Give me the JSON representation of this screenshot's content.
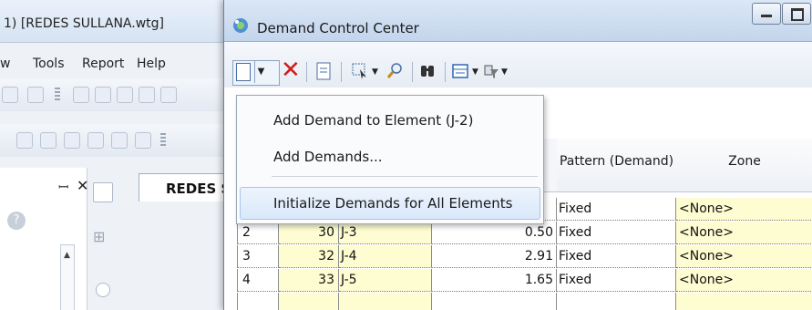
{
  "background_app": {
    "title": "1) [REDES SULLANA.wtg]",
    "menu": [
      {
        "label": "w"
      },
      {
        "label": "Tools"
      },
      {
        "label": "Report"
      },
      {
        "label": "Help"
      }
    ],
    "document_tab": "REDES S"
  },
  "dialog": {
    "title": "Demand Control Center",
    "toolbar": {
      "icons": [
        "new-icon",
        "dropdown-icon",
        "delete-icon",
        "report-icon",
        "select-icon",
        "zoom-icon",
        "find-icon",
        "columns-icon",
        "filter-icon"
      ]
    },
    "new_menu": {
      "items": [
        "Add Demand to Element (J-2)",
        "Add Demands...",
        "Initialize Demands for All Elements"
      ]
    },
    "grid": {
      "columns": [
        "Pattern (Demand)",
        "Zone"
      ],
      "rows": [
        {
          "index": "",
          "id": "",
          "label": "",
          "demand": "",
          "pattern": "Fixed",
          "zone": "<None>"
        },
        {
          "index": "2",
          "id": "30",
          "label": "J-3",
          "demand": "0.50",
          "pattern": "Fixed",
          "zone": "<None>"
        },
        {
          "index": "3",
          "id": "32",
          "label": "J-4",
          "demand": "2.91",
          "pattern": "Fixed",
          "zone": "<None>"
        },
        {
          "index": "4",
          "id": "33",
          "label": "J-5",
          "demand": "1.65",
          "pattern": "Fixed",
          "zone": "<None>"
        }
      ]
    },
    "colors": {
      "highlight": "#fefcd1",
      "menu_hover": "#dae8fa",
      "delete": "#d21b1b"
    }
  }
}
